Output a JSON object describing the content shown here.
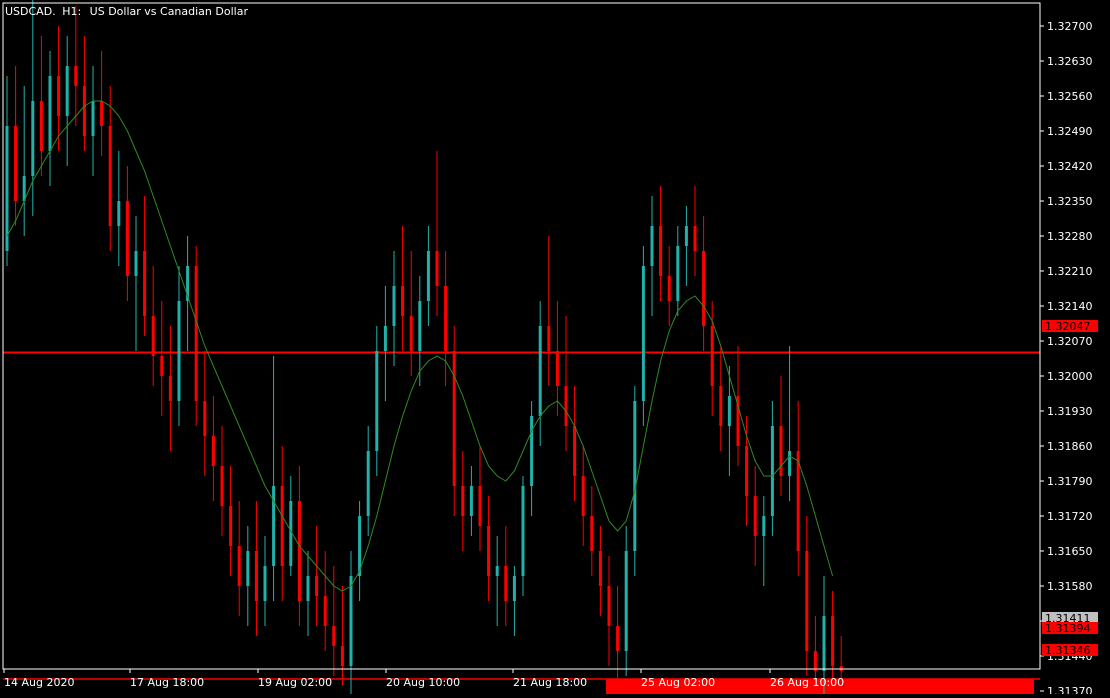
{
  "header": {
    "symbol": "USDCAD.",
    "timeframe": "H1:",
    "description": "US Dollar vs Canadian Dollar"
  },
  "colors": {
    "background": "#000000",
    "frame": "#ffffff",
    "bull": "#20b2aa",
    "bear": "#ff0000",
    "ma": "#2e8b22",
    "hline": "#ff0000",
    "zone": "#ff0000",
    "axis_text": "#ffffff",
    "price_marker_bg": "#c0c0c0"
  },
  "chart_data": {
    "type": "candlestick",
    "title": "USDCAD., H1:  US Dollar vs Canadian Dollar",
    "ylim": [
      1.3128,
      1.3277
    ],
    "y_ticks": [
      "1.32700",
      "1.32630",
      "1.32560",
      "1.32490",
      "1.32420",
      "1.32350",
      "1.32280",
      "1.32210",
      "1.32140",
      "1.32070",
      "1.32000",
      "1.31930",
      "1.31860",
      "1.31790",
      "1.31720",
      "1.31650",
      "1.31580",
      "1.31510",
      "1.31440",
      "1.31370"
    ],
    "x_ticks": [
      "14 Aug 2020",
      "17 Aug 18:00",
      "19 Aug 02:00",
      "20 Aug 10:00",
      "21 Aug 18:00",
      "25 Aug 02:00",
      "26 Aug 10:00"
    ],
    "price_labels": [
      {
        "text": "1.32047",
        "style": "red"
      },
      {
        "text": "1.31411",
        "style": "grey"
      },
      {
        "text": "1.31394",
        "style": "red"
      },
      {
        "text": "1.31346",
        "style": "red"
      }
    ],
    "horizontal_lines": [
      1.32047,
      1.31394,
      1.31346
    ],
    "zone": {
      "top": 1.31394,
      "bottom": 1.31346,
      "start_candle": 70
    },
    "ma_series": [
      {
        "from": 0,
        "values": [
          1.3228,
          1.3231,
          1.3235,
          1.3239,
          1.3242,
          1.3245,
          1.3248,
          1.325,
          1.3252,
          1.3254,
          1.3255,
          1.3255,
          1.3254,
          1.3252,
          1.3249,
          1.3245,
          1.3241,
          1.3236,
          1.3231,
          1.3226,
          1.3221,
          1.3216,
          1.3211,
          1.3206,
          1.3202,
          1.3198,
          1.3194,
          1.319,
          1.3186,
          1.3182,
          1.3178,
          1.3175,
          1.3172,
          1.3169,
          1.3166,
          1.3164,
          1.3162,
          1.316,
          1.3158,
          1.3157,
          1.3158,
          1.3161,
          1.3166,
          1.3172,
          1.3179,
          1.3186,
          1.3192,
          1.3197,
          1.3201,
          1.3203,
          1.3204,
          1.3203,
          1.32,
          1.3196,
          1.3191,
          1.3186,
          1.3182,
          1.318,
          1.3179,
          1.3181,
          1.3185,
          1.3189,
          1.3192,
          1.3194,
          1.3195,
          1.3193,
          1.319,
          1.3186,
          1.3181,
          1.3176,
          1.3171,
          1.3169,
          1.3171,
          1.3177,
          1.3186,
          1.3195,
          1.3203,
          1.3209,
          1.3213,
          1.3215,
          1.3216,
          1.3214,
          1.3211,
          1.3206,
          1.32,
          1.3194,
          1.3188,
          1.3183,
          1.318,
          1.318,
          1.3182,
          1.3184,
          1.3183,
          1.3178,
          1.3172,
          1.3166,
          1.316
        ]
      }
    ],
    "candles": [
      {
        "o": 1.3225,
        "h": 1.326,
        "l": 1.3222,
        "c": 1.325
      },
      {
        "o": 1.325,
        "h": 1.3262,
        "l": 1.323,
        "c": 1.3235
      },
      {
        "o": 1.3235,
        "h": 1.3258,
        "l": 1.3228,
        "c": 1.324
      },
      {
        "o": 1.324,
        "h": 1.3276,
        "l": 1.3232,
        "c": 1.3255
      },
      {
        "o": 1.3255,
        "h": 1.3268,
        "l": 1.324,
        "c": 1.3245
      },
      {
        "o": 1.3245,
        "h": 1.3265,
        "l": 1.3238,
        "c": 1.326
      },
      {
        "o": 1.326,
        "h": 1.327,
        "l": 1.3245,
        "c": 1.3252
      },
      {
        "o": 1.3252,
        "h": 1.3268,
        "l": 1.3242,
        "c": 1.3262
      },
      {
        "o": 1.3262,
        "h": 1.3274,
        "l": 1.325,
        "c": 1.3258
      },
      {
        "o": 1.3258,
        "h": 1.3268,
        "l": 1.3245,
        "c": 1.3248
      },
      {
        "o": 1.3248,
        "h": 1.3262,
        "l": 1.324,
        "c": 1.3255
      },
      {
        "o": 1.3255,
        "h": 1.3265,
        "l": 1.3244,
        "c": 1.325
      },
      {
        "o": 1.325,
        "h": 1.3258,
        "l": 1.3225,
        "c": 1.323
      },
      {
        "o": 1.323,
        "h": 1.3245,
        "l": 1.3222,
        "c": 1.3235
      },
      {
        "o": 1.3235,
        "h": 1.3242,
        "l": 1.3215,
        "c": 1.322
      },
      {
        "o": 1.322,
        "h": 1.3232,
        "l": 1.3205,
        "c": 1.3225
      },
      {
        "o": 1.3225,
        "h": 1.3236,
        "l": 1.3208,
        "c": 1.3212
      },
      {
        "o": 1.3212,
        "h": 1.3222,
        "l": 1.3198,
        "c": 1.3204
      },
      {
        "o": 1.3204,
        "h": 1.3215,
        "l": 1.3192,
        "c": 1.32
      },
      {
        "o": 1.32,
        "h": 1.321,
        "l": 1.3185,
        "c": 1.3195
      },
      {
        "o": 1.3195,
        "h": 1.3222,
        "l": 1.319,
        "c": 1.3215
      },
      {
        "o": 1.3215,
        "h": 1.3228,
        "l": 1.3205,
        "c": 1.3222
      },
      {
        "o": 1.3222,
        "h": 1.3226,
        "l": 1.319,
        "c": 1.3195
      },
      {
        "o": 1.3195,
        "h": 1.3205,
        "l": 1.318,
        "c": 1.3188
      },
      {
        "o": 1.3188,
        "h": 1.3196,
        "l": 1.3175,
        "c": 1.3182
      },
      {
        "o": 1.3182,
        "h": 1.319,
        "l": 1.3168,
        "c": 1.3174
      },
      {
        "o": 1.3174,
        "h": 1.3182,
        "l": 1.316,
        "c": 1.3166
      },
      {
        "o": 1.3166,
        "h": 1.3175,
        "l": 1.3152,
        "c": 1.3158
      },
      {
        "o": 1.3158,
        "h": 1.317,
        "l": 1.315,
        "c": 1.3165
      },
      {
        "o": 1.3165,
        "h": 1.3175,
        "l": 1.3148,
        "c": 1.3155
      },
      {
        "o": 1.3155,
        "h": 1.3168,
        "l": 1.315,
        "c": 1.3162
      },
      {
        "o": 1.3162,
        "h": 1.3204,
        "l": 1.3155,
        "c": 1.3178
      },
      {
        "o": 1.3178,
        "h": 1.3186,
        "l": 1.3155,
        "c": 1.3162
      },
      {
        "o": 1.3162,
        "h": 1.318,
        "l": 1.316,
        "c": 1.3175
      },
      {
        "o": 1.3175,
        "h": 1.3182,
        "l": 1.315,
        "c": 1.3155
      },
      {
        "o": 1.3155,
        "h": 1.3165,
        "l": 1.3148,
        "c": 1.316
      },
      {
        "o": 1.316,
        "h": 1.317,
        "l": 1.315,
        "c": 1.3156
      },
      {
        "o": 1.3156,
        "h": 1.3165,
        "l": 1.3145,
        "c": 1.315
      },
      {
        "o": 1.315,
        "h": 1.3162,
        "l": 1.314,
        "c": 1.3146
      },
      {
        "o": 1.3146,
        "h": 1.3158,
        "l": 1.3138,
        "c": 1.3142
      },
      {
        "o": 1.3142,
        "h": 1.3165,
        "l": 1.3136,
        "c": 1.316
      },
      {
        "o": 1.316,
        "h": 1.3175,
        "l": 1.3155,
        "c": 1.3172
      },
      {
        "o": 1.3172,
        "h": 1.319,
        "l": 1.3168,
        "c": 1.3185
      },
      {
        "o": 1.3185,
        "h": 1.321,
        "l": 1.318,
        "c": 1.3205
      },
      {
        "o": 1.3205,
        "h": 1.3218,
        "l": 1.3195,
        "c": 1.321
      },
      {
        "o": 1.321,
        "h": 1.3225,
        "l": 1.3202,
        "c": 1.3218
      },
      {
        "o": 1.3218,
        "h": 1.323,
        "l": 1.3205,
        "c": 1.3212
      },
      {
        "o": 1.3212,
        "h": 1.3225,
        "l": 1.32,
        "c": 1.3205
      },
      {
        "o": 1.3205,
        "h": 1.322,
        "l": 1.3198,
        "c": 1.3215
      },
      {
        "o": 1.3215,
        "h": 1.323,
        "l": 1.321,
        "c": 1.3225
      },
      {
        "o": 1.3225,
        "h": 1.3245,
        "l": 1.3212,
        "c": 1.3218
      },
      {
        "o": 1.3218,
        "h": 1.3225,
        "l": 1.3198,
        "c": 1.3205
      },
      {
        "o": 1.3205,
        "h": 1.321,
        "l": 1.3172,
        "c": 1.3178
      },
      {
        "o": 1.3178,
        "h": 1.3185,
        "l": 1.3165,
        "c": 1.3172
      },
      {
        "o": 1.3172,
        "h": 1.3182,
        "l": 1.3168,
        "c": 1.3178
      },
      {
        "o": 1.3178,
        "h": 1.3186,
        "l": 1.3165,
        "c": 1.317
      },
      {
        "o": 1.317,
        "h": 1.3176,
        "l": 1.3155,
        "c": 1.316
      },
      {
        "o": 1.316,
        "h": 1.3168,
        "l": 1.315,
        "c": 1.3162
      },
      {
        "o": 1.3162,
        "h": 1.317,
        "l": 1.315,
        "c": 1.3155
      },
      {
        "o": 1.3155,
        "h": 1.3162,
        "l": 1.3148,
        "c": 1.316
      },
      {
        "o": 1.316,
        "h": 1.318,
        "l": 1.3156,
        "c": 1.3178
      },
      {
        "o": 1.3178,
        "h": 1.3195,
        "l": 1.3172,
        "c": 1.3192
      },
      {
        "o": 1.3192,
        "h": 1.3215,
        "l": 1.3186,
        "c": 1.321
      },
      {
        "o": 1.321,
        "h": 1.3228,
        "l": 1.3198,
        "c": 1.3205
      },
      {
        "o": 1.3205,
        "h": 1.3215,
        "l": 1.3192,
        "c": 1.3198
      },
      {
        "o": 1.3198,
        "h": 1.3212,
        "l": 1.3185,
        "c": 1.319
      },
      {
        "o": 1.319,
        "h": 1.3198,
        "l": 1.3175,
        "c": 1.318
      },
      {
        "o": 1.318,
        "h": 1.3186,
        "l": 1.3166,
        "c": 1.3172
      },
      {
        "o": 1.3172,
        "h": 1.3178,
        "l": 1.316,
        "c": 1.3165
      },
      {
        "o": 1.3165,
        "h": 1.317,
        "l": 1.3152,
        "c": 1.3158
      },
      {
        "o": 1.3158,
        "h": 1.3164,
        "l": 1.3142,
        "c": 1.315
      },
      {
        "o": 1.315,
        "h": 1.3158,
        "l": 1.3137,
        "c": 1.3145
      },
      {
        "o": 1.3145,
        "h": 1.317,
        "l": 1.314,
        "c": 1.3165
      },
      {
        "o": 1.3165,
        "h": 1.3198,
        "l": 1.316,
        "c": 1.3195
      },
      {
        "o": 1.3195,
        "h": 1.3226,
        "l": 1.319,
        "c": 1.3222
      },
      {
        "o": 1.3222,
        "h": 1.3236,
        "l": 1.3212,
        "c": 1.323
      },
      {
        "o": 1.323,
        "h": 1.3238,
        "l": 1.3215,
        "c": 1.322
      },
      {
        "o": 1.322,
        "h": 1.3226,
        "l": 1.321,
        "c": 1.3215
      },
      {
        "o": 1.3215,
        "h": 1.323,
        "l": 1.3212,
        "c": 1.3226
      },
      {
        "o": 1.3226,
        "h": 1.3234,
        "l": 1.3218,
        "c": 1.323
      },
      {
        "o": 1.323,
        "h": 1.3238,
        "l": 1.322,
        "c": 1.3225
      },
      {
        "o": 1.3225,
        "h": 1.3232,
        "l": 1.3205,
        "c": 1.321
      },
      {
        "o": 1.321,
        "h": 1.3215,
        "l": 1.3192,
        "c": 1.3198
      },
      {
        "o": 1.3198,
        "h": 1.3206,
        "l": 1.3185,
        "c": 1.319
      },
      {
        "o": 1.319,
        "h": 1.3202,
        "l": 1.318,
        "c": 1.3196
      },
      {
        "o": 1.3196,
        "h": 1.3206,
        "l": 1.3182,
        "c": 1.3186
      },
      {
        "o": 1.3186,
        "h": 1.3192,
        "l": 1.317,
        "c": 1.3176
      },
      {
        "o": 1.3176,
        "h": 1.3182,
        "l": 1.3162,
        "c": 1.3168
      },
      {
        "o": 1.3168,
        "h": 1.3176,
        "l": 1.3158,
        "c": 1.3172
      },
      {
        "o": 1.3172,
        "h": 1.3195,
        "l": 1.3168,
        "c": 1.319
      },
      {
        "o": 1.319,
        "h": 1.32,
        "l": 1.3176,
        "c": 1.318
      },
      {
        "o": 1.318,
        "h": 1.3206,
        "l": 1.3175,
        "c": 1.3185
      },
      {
        "o": 1.3185,
        "h": 1.3195,
        "l": 1.316,
        "c": 1.3165
      },
      {
        "o": 1.3165,
        "h": 1.3172,
        "l": 1.314,
        "c": 1.3145
      },
      {
        "o": 1.3145,
        "h": 1.3152,
        "l": 1.3138,
        "c": 1.3141
      },
      {
        "o": 1.3141,
        "h": 1.316,
        "l": 1.3136,
        "c": 1.3152
      },
      {
        "o": 1.3152,
        "h": 1.3157,
        "l": 1.3139,
        "c": 1.3142
      },
      {
        "o": 1.3142,
        "h": 1.3148,
        "l": 1.3138,
        "c": 1.3141
      }
    ]
  }
}
